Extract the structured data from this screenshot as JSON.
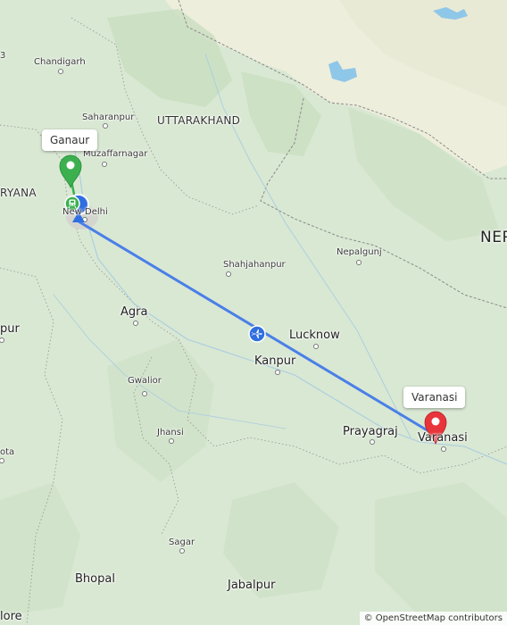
{
  "markers": {
    "origin": {
      "label": "Ganaur",
      "color": "#3cb04f"
    },
    "destination": {
      "label": "Varanasi",
      "color": "#e8343b"
    },
    "station_icon": "train-station-icon",
    "current_location_color": "#2f6fe0"
  },
  "route": {
    "color": "#4a7fe8",
    "mode_icon": "airplane-icon"
  },
  "places": {
    "chandigarh": "Chandigarh",
    "saharanpur": "Saharanpur",
    "uttarakhand": "UTTARAKHAND",
    "muzaffarnagar": "Muzaffarnagar",
    "haryana": "RYANA",
    "new_delhi": "New Delhi",
    "nepal": "NEP",
    "nepalgunj": "Nepalgunj",
    "shahjahanpur": "Shahjahanpur",
    "agra": "Agra",
    "lucknow": "Lucknow",
    "kanpur": "Kanpur",
    "pur_left": "pur",
    "gwalior": "Gwalior",
    "jhansi": "Jhansi",
    "prayagraj": "Prayagraj",
    "varanasi": "Varanasi",
    "kota": "ota",
    "sagar": "Sagar",
    "bhopal": "Bhopal",
    "jabalpur": "Jabalpur",
    "indore": "lore",
    "edge_3": "3"
  },
  "attribution": "© OpenStreetMap contributors"
}
